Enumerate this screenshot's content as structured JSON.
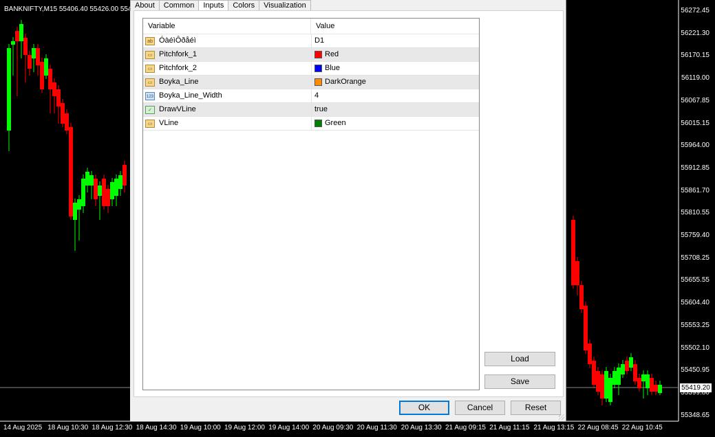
{
  "chart": {
    "title": "BANKNIFTY,M15  55406.40 55426.00 554",
    "current_price": "55419.20",
    "price_axis": [
      "56272.45",
      "56221.30",
      "56170.15",
      "56119.00",
      "56067.85",
      "56015.15",
      "55964.00",
      "55912.85",
      "55861.70",
      "55810.55",
      "55759.40",
      "55708.25",
      "55655.55",
      "55604.40",
      "55553.25",
      "55502.10",
      "55450.95",
      "55399.80",
      "55348.65"
    ],
    "time_axis": [
      "14 Aug 2025",
      "18 Aug 10:30",
      "18 Aug 12:30",
      "18 Aug 14:30",
      "19 Aug 10:00",
      "19 Aug 12:00",
      "19 Aug 14:00",
      "20 Aug 09:30",
      "20 Aug 11:30",
      "20 Aug 13:30",
      "21 Aug 09:15",
      "21 Aug 11:15",
      "21 Aug 13:15",
      "22 Aug 08:45",
      "22 Aug 10:45"
    ],
    "colors": {
      "up": "#00ff00",
      "down": "#ff0000",
      "background": "#000000",
      "text": "#ffffff"
    }
  },
  "dialog": {
    "tabs": [
      "About",
      "Common",
      "Inputs",
      "Colors",
      "Visualization"
    ],
    "active_tab": "Inputs",
    "grid": {
      "headers": {
        "variable": "Variable",
        "value": "Value"
      },
      "rows": [
        {
          "icon": "ab",
          "name": "ÓàéìÔðåéì",
          "value": "D1",
          "color": null
        },
        {
          "icon": "color",
          "name": "Pitchfork_1",
          "value": "Red",
          "color": "#ff0000"
        },
        {
          "icon": "color",
          "name": "Pitchfork_2",
          "value": "Blue",
          "color": "#0000ff"
        },
        {
          "icon": "color",
          "name": "Boyka_Line",
          "value": "DarkOrange",
          "color": "#ff8c00"
        },
        {
          "icon": "123",
          "name": "Boyka_Line_Width",
          "value": "4",
          "color": null
        },
        {
          "icon": "bool",
          "name": "DrawVLine",
          "value": "true",
          "color": null
        },
        {
          "icon": "color",
          "name": "VLine",
          "value": "Green",
          "color": "#008000"
        }
      ]
    },
    "buttons": {
      "load": "Load",
      "save": "Save",
      "ok": "OK",
      "cancel": "Cancel",
      "reset": "Reset"
    }
  }
}
